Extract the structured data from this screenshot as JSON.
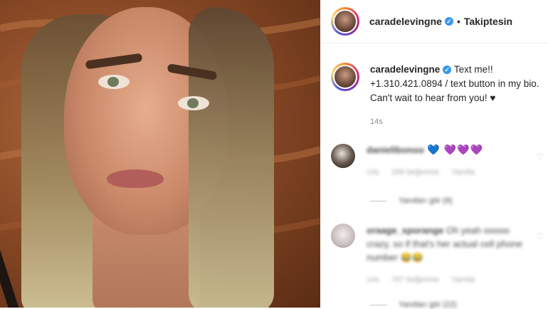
{
  "post": {
    "username": "caradelevingne",
    "follow_status": "Takiptesin"
  },
  "caption": {
    "username": "caradelevingne",
    "text": "Text me!! +1.310.421.0894 / text button in my bio. Can't wait to hear from you! ♥",
    "time": "14s"
  },
  "comments": [
    {
      "username": "danielibonoo",
      "text": "💙 💜💜💜",
      "time": "14s",
      "likes": "299 beğenme",
      "reply_label": "Yanıtla",
      "replies": "Yanıtları gör (8)"
    },
    {
      "username": "oraage_sporange",
      "text": "Oh yeah ooooo crazy, so if that's her actual cell phone number 😂😂",
      "time": "14s",
      "likes": "787 beğenme",
      "reply_label": "Yanıtla",
      "replies": "Yanıtları gör (22)"
    }
  ],
  "icons": {
    "verified": "verified-badge-icon",
    "like": "heart-outline-icon"
  },
  "colors": {
    "verified_blue": "#3897f0",
    "text_dark": "#262626",
    "text_muted": "#8e8e8e"
  }
}
